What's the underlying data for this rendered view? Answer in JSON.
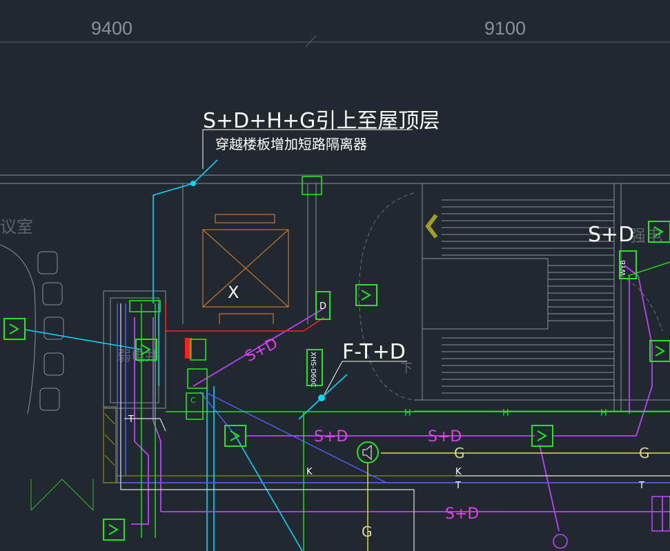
{
  "dimensions": [
    "9400",
    "9100"
  ],
  "annotations": {
    "riser_line1": "S+D+H+G引上至屋顶层",
    "riser_line2": "穿越楼板增加短路隔离器",
    "ftd": "F-T+D",
    "sd_top_right": "S+D",
    "diag_sd": "S+D",
    "elevator_x": "X"
  },
  "rooms": {
    "left": "议室",
    "right": "强电",
    "center": "弱电井",
    "stair_down": "下"
  },
  "bus_labels": {
    "sd_1": "S+D",
    "sd_2": "S+D",
    "sd_3": "S+D",
    "g_1": "G",
    "g_2": "G",
    "g_3": "G",
    "t_1": "T",
    "t_2": "T",
    "t_3": "T",
    "k_1": "K",
    "k_2": "K",
    "h_1": "H",
    "h_2": "H",
    "h_3": "H"
  },
  "devices": {
    "module_d": "D",
    "vertical_box": "XHS-D60C",
    "wyb": "WYB"
  },
  "colors": {
    "background": "#212830",
    "wall": "#9aa0a6",
    "cyan": "#00d8ff",
    "magenta": "#d040ff",
    "green": "#22e622",
    "yellow": "#e6e640",
    "red": "#ff2020",
    "olive": "#8a8a20",
    "orange": "#c87530",
    "blue": "#4060ff"
  }
}
